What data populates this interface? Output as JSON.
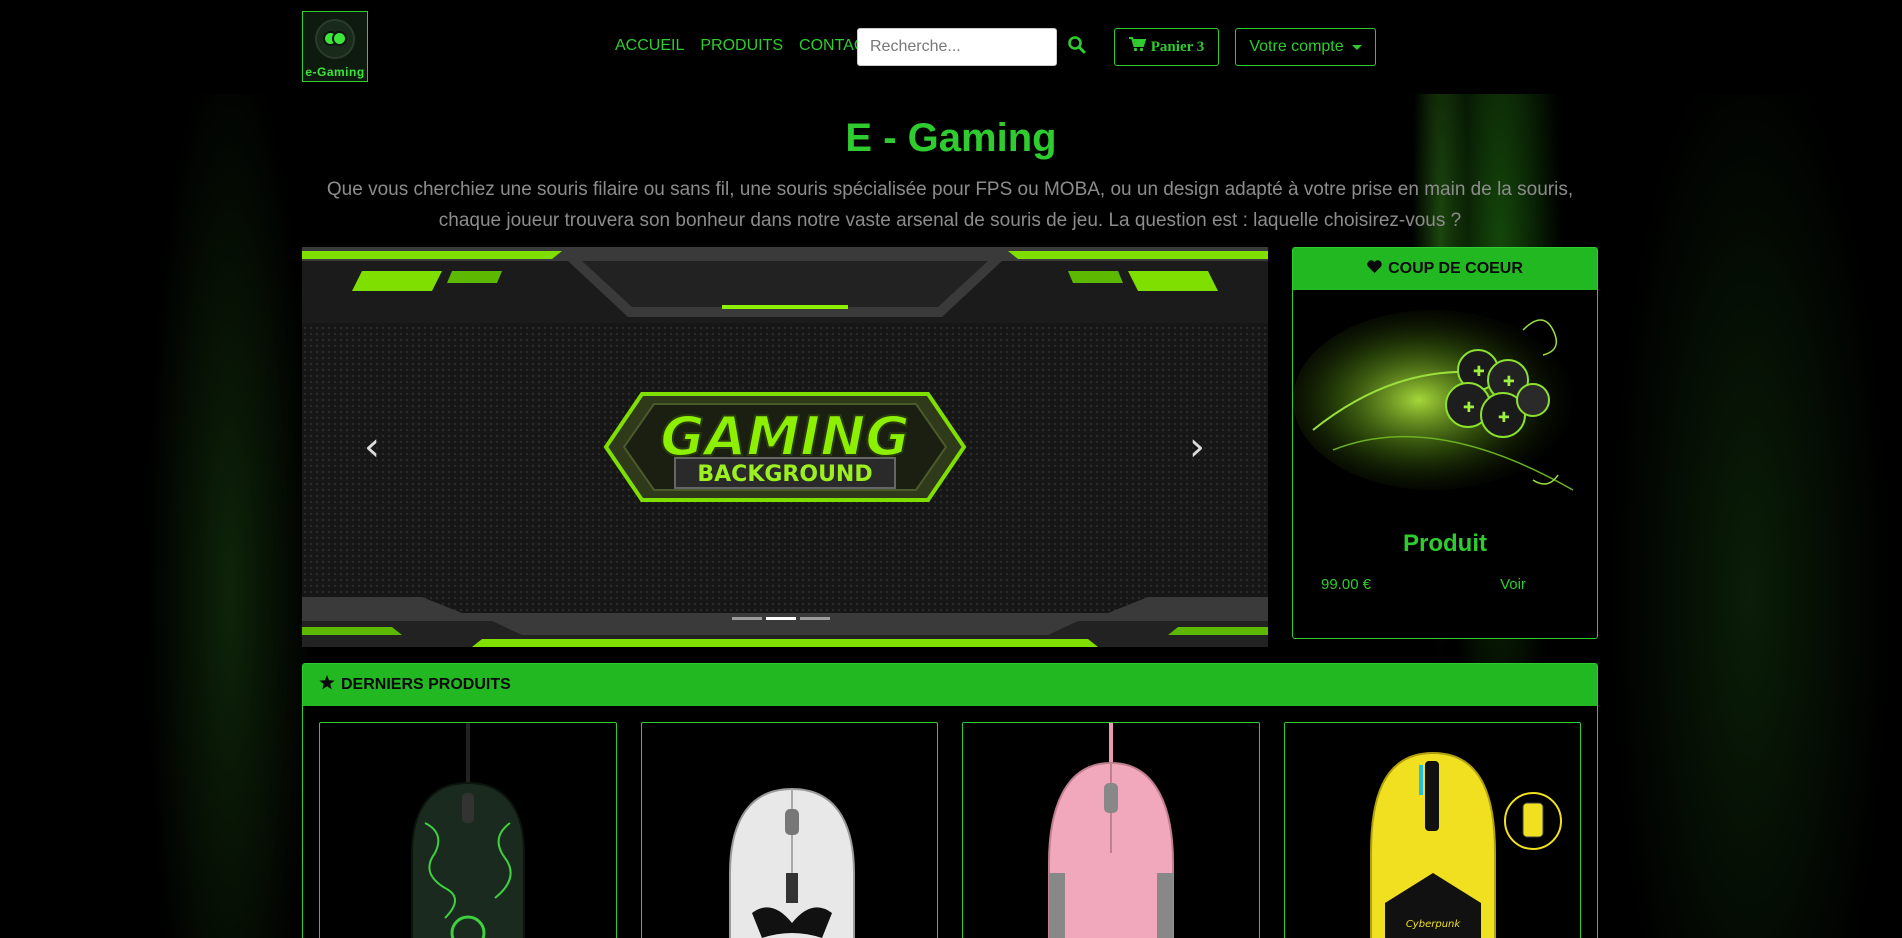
{
  "logo": {
    "text": "e-Gaming"
  },
  "nav": {
    "items": [
      "ACCUEIL",
      "PRODUITS",
      "CONTACT"
    ]
  },
  "search": {
    "placeholder": "Recherche..."
  },
  "cart": {
    "label": "Panier 3"
  },
  "account": {
    "label": "Votre compte"
  },
  "hero": {
    "title": "E - Gaming",
    "subtitle": "Que vous cherchiez une souris filaire ou sans fil, une souris spécialisée pour FPS ou MOBA, ou un design adapté à votre prise en main de la souris, chaque joueur trouvera son bonheur dans notre vaste arsenal de souris de jeu. La question est : laquelle choisirez-vous ?"
  },
  "carousel": {
    "image_text_1": "GAMING",
    "image_text_2": "BACKGROUND",
    "slides": 3,
    "active_slide": 2
  },
  "coup_de_coeur": {
    "header": "COUP DE COEUR",
    "name": "Produit",
    "price": "99.00 €",
    "link": "Voir"
  },
  "latest": {
    "header": "DERNIERS PRODUITS",
    "products": [
      {
        "icon": "razer-green-mouse"
      },
      {
        "icon": "stormtrooper-mouse"
      },
      {
        "icon": "pink-mouse"
      },
      {
        "icon": "cyberpunk-yellow-mouse"
      }
    ]
  },
  "colors": {
    "accent": "#2ecc2e",
    "header_bar": "#22b822",
    "background": "#000000"
  }
}
